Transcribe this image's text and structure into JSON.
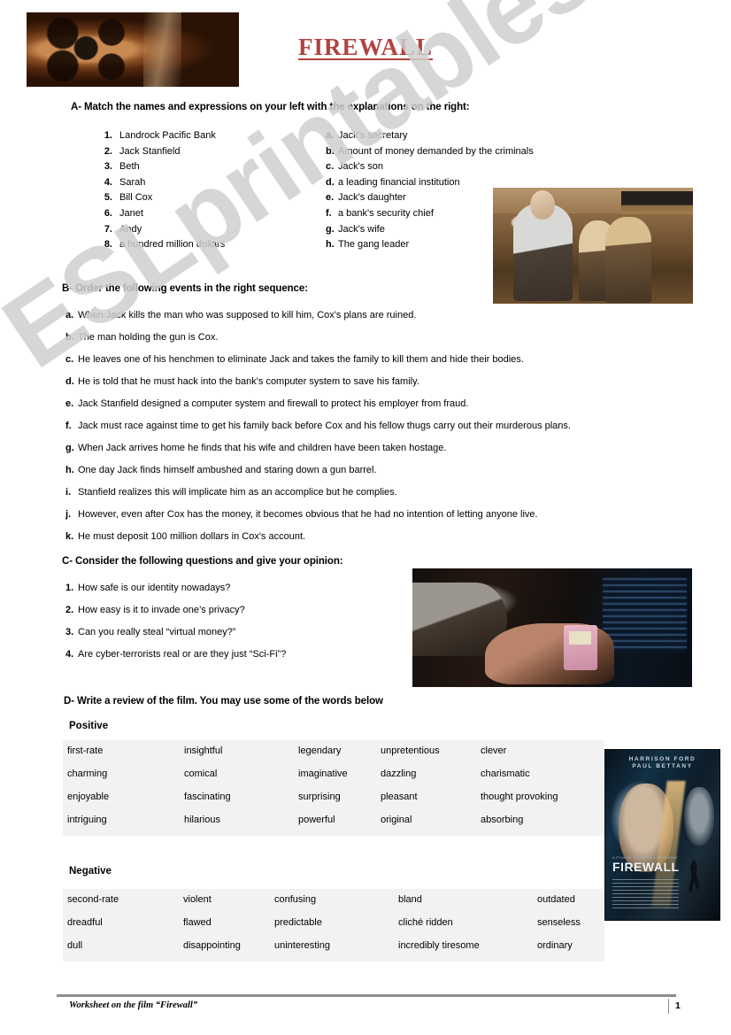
{
  "document": {
    "title": "FIREWALL",
    "footer_text": "Worksheet on the film “Firewall”",
    "page_number": "1",
    "watermark": "ESLprintables.co",
    "accent_color": "#b2423f",
    "table_bg_color": "#f2f2f2"
  },
  "images": {
    "header_reel_alt": "film-reel",
    "family_photo_alt": "family-hostage-scene",
    "hacking_photo_alt": "hands-with-device-and-monitor",
    "poster": {
      "alt": "firewall-movie-poster",
      "actor_1": "HARRISON FORD",
      "actor_2": "PAUL BETTANY",
      "title": "FIREWALL",
      "billing": "A FILM BY RICHARD LONCRAINE"
    }
  },
  "section_a": {
    "heading": "A- Match the names and expressions on your left with the explanations on the right:",
    "left_column": [
      {
        "marker": "1.",
        "text": "Landrock Pacific Bank"
      },
      {
        "marker": "2.",
        "text": "Jack Stanfield"
      },
      {
        "marker": "3.",
        "text": "Beth"
      },
      {
        "marker": "4.",
        "text": "Sarah"
      },
      {
        "marker": "5.",
        "text": "Bill Cox"
      },
      {
        "marker": "6.",
        "text": "Janet"
      },
      {
        "marker": "7.",
        "text": "Andy"
      },
      {
        "marker": "8.",
        "text": "a hundred million dollars"
      }
    ],
    "right_column": [
      {
        "marker": "a.",
        "text": "Jack's secretary"
      },
      {
        "marker": "b.",
        "text": "Amount of money demanded by the criminals"
      },
      {
        "marker": "c.",
        "text": "Jack's son"
      },
      {
        "marker": "d.",
        "text": "a leading financial institution"
      },
      {
        "marker": "e.",
        "text": "Jack's daughter"
      },
      {
        "marker": "f.",
        "text": "a bank's security chief"
      },
      {
        "marker": "g.",
        "text": "Jack's wife"
      },
      {
        "marker": "h.",
        "text": "The gang leader"
      }
    ]
  },
  "section_b": {
    "heading": "B- Order the following events in the right sequence:",
    "items": [
      {
        "marker": "a.",
        "text": "When Jack kills the man who was supposed to kill him, Cox's plans are ruined."
      },
      {
        "marker": "b.",
        "text": "The man holding the gun is Cox."
      },
      {
        "marker": "c.",
        "text": "He leaves one of his henchmen to eliminate Jack and takes the family to kill them and hide their bodies."
      },
      {
        "marker": "d.",
        "text": "He is told that he must hack into the bank's computer system to save his family."
      },
      {
        "marker": "e.",
        "text": "Jack Stanfield designed a computer system and firewall to protect his employer from fraud."
      },
      {
        "marker": "f.",
        "text": "Jack must race against time to get his family back before Cox and his fellow thugs carry out their murderous plans."
      },
      {
        "marker": "g.",
        "text": "When Jack arrives home he finds that his wife and children have been taken hostage."
      },
      {
        "marker": "h.",
        "text": "One day Jack finds himself ambushed and staring down a gun barrel."
      },
      {
        "marker": "i.",
        "text": "Stanfield realizes this will implicate him as an accomplice but he complies."
      },
      {
        "marker": "j.",
        "text": "However, even after Cox has the money, it becomes obvious that he had no intention of letting anyone live."
      },
      {
        "marker": "k.",
        "text": "He must deposit 100 million dollars in Cox's account."
      }
    ]
  },
  "section_c": {
    "heading": "C- Consider the following questions and give your opinion:",
    "items": [
      {
        "marker": "1.",
        "text": "How safe is our identity nowadays?"
      },
      {
        "marker": "2.",
        "text": "How easy is it to invade one’s privacy?"
      },
      {
        "marker": "3.",
        "text": "Can you really steal “virtual money?”"
      },
      {
        "marker": "4.",
        "text": "Are cyber-terrorists real or are they just “Sci-Fi”?"
      }
    ]
  },
  "section_d": {
    "heading": "D- Write a review of the film. You may use some of the words below",
    "positive_label": "Positive",
    "negative_label": "Negative",
    "positive_rows": [
      [
        "first-rate",
        "insightful",
        "legendary",
        "unpretentious",
        "clever"
      ],
      [
        "charming",
        "comical",
        "imaginative",
        "dazzling",
        "charismatic"
      ],
      [
        "enjoyable",
        "fascinating",
        "surprising",
        "pleasant",
        "thought provoking"
      ],
      [
        "intriguing",
        "hilarious",
        "powerful",
        "original",
        "absorbing"
      ]
    ],
    "negative_rows": [
      [
        "second-rate",
        "violent",
        "confusing",
        "bland",
        "outdated"
      ],
      [
        "dreadful",
        "flawed",
        "predictable",
        "cliché ridden",
        "senseless"
      ],
      [
        "dull",
        "disappointing",
        "uninteresting",
        "incredibly tiresome",
        "ordinary"
      ]
    ]
  }
}
